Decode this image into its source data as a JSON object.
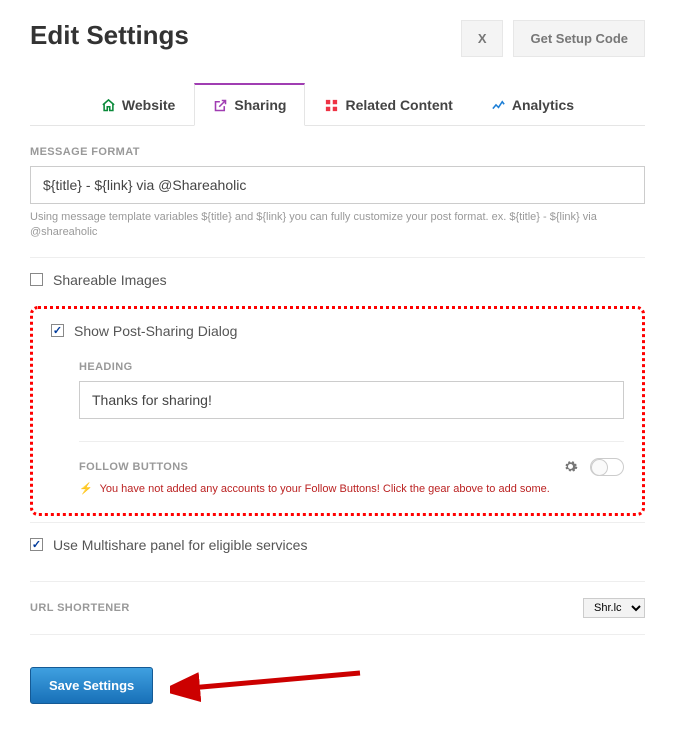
{
  "page": {
    "title": "Edit Settings"
  },
  "headerButtons": {
    "close": "X",
    "setup": "Get Setup Code"
  },
  "tabs": {
    "website": "Website",
    "sharing": "Sharing",
    "related": "Related Content",
    "analytics": "Analytics"
  },
  "messageFormat": {
    "label": "MESSAGE FORMAT",
    "value": "${title} - ${link} via @Shareaholic",
    "help": "Using message template variables ${title} and ${link} you can fully customize your post format. ex. ${title} - ${link} via @shareaholic"
  },
  "options": {
    "shareableImages": "Shareable Images",
    "showDialog": "Show Post-Sharing Dialog",
    "multishare": "Use Multishare panel for eligible services"
  },
  "heading": {
    "label": "HEADING",
    "value": "Thanks for sharing!"
  },
  "followButtons": {
    "label": "FOLLOW BUTTONS",
    "warning": "You have not added any accounts to your Follow Buttons! Click the gear above to add some."
  },
  "urlShortener": {
    "label": "URL SHORTENER",
    "selected": "Shr.lc"
  },
  "actions": {
    "save": "Save Settings"
  }
}
